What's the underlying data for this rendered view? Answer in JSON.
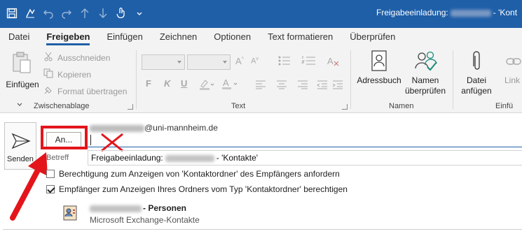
{
  "window": {
    "title_prefix": "Freigabeeinladung:",
    "title_suffix": "- 'Kont"
  },
  "tabs": [
    "Datei",
    "Freigeben",
    "Einfügen",
    "Zeichnen",
    "Optionen",
    "Text formatieren",
    "Überprüfen"
  ],
  "active_tab": "Freigeben",
  "ribbon": {
    "clipboard": {
      "paste_label": "Einfügen",
      "cut_label": "Ausschneiden",
      "copy_label": "Kopieren",
      "format_label": "Format übertragen",
      "group_label": "Zwischenablage"
    },
    "text": {
      "group_label": "Text"
    },
    "names": {
      "addressbook_label": "Adressbuch",
      "check_names_label": "Namen überprüfen",
      "group_label": "Namen"
    },
    "insert": {
      "attach_label": "Datei anfügen",
      "link_label": "Link",
      "group_label": "Einfü"
    }
  },
  "compose": {
    "send_label": "Senden",
    "from_domain": "@uni-mannheim.de",
    "to_button_label": "An...",
    "subject_label": "Betreff",
    "subject_prefix": "Freigabeeinladung:",
    "subject_suffix": "- 'Kontakte'",
    "checkbox1_label": "Berechtigung zum Anzeigen von 'Kontaktordner' des Empfängers anfordern",
    "checkbox1_checked": false,
    "checkbox2_label": "Empfänger zum Anzeigen Ihres Ordners vom Typ 'Kontaktordner' berechtigen",
    "checkbox2_checked": true,
    "contact_suffix": "- Personen",
    "contact_sub": "Microsoft Exchange-Kontakte"
  },
  "colors": {
    "titlebar": "#1f5fa8",
    "highlight": "#e3151b"
  }
}
